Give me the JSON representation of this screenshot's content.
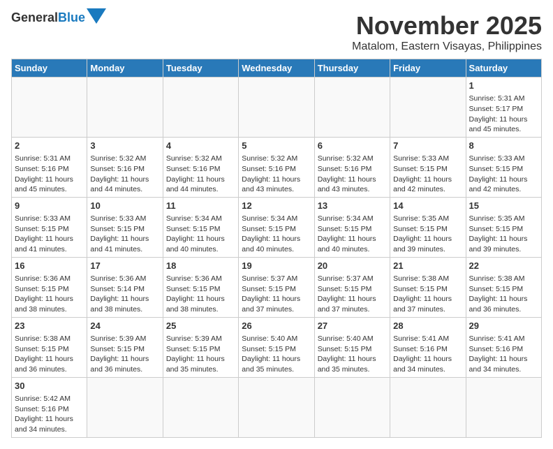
{
  "header": {
    "logo_general": "General",
    "logo_blue": "Blue",
    "month_year": "November 2025",
    "location": "Matalom, Eastern Visayas, Philippines"
  },
  "days_of_week": [
    "Sunday",
    "Monday",
    "Tuesday",
    "Wednesday",
    "Thursday",
    "Friday",
    "Saturday"
  ],
  "weeks": [
    [
      {
        "day": "",
        "empty": true
      },
      {
        "day": "",
        "empty": true
      },
      {
        "day": "",
        "empty": true
      },
      {
        "day": "",
        "empty": true
      },
      {
        "day": "",
        "empty": true
      },
      {
        "day": "",
        "empty": true
      },
      {
        "day": "1",
        "sunrise": "Sunrise: 5:31 AM",
        "sunset": "Sunset: 5:17 PM",
        "daylight": "Daylight: 11 hours and 45 minutes."
      }
    ],
    [
      {
        "day": "2",
        "sunrise": "Sunrise: 5:31 AM",
        "sunset": "Sunset: 5:16 PM",
        "daylight": "Daylight: 11 hours and 45 minutes."
      },
      {
        "day": "3",
        "sunrise": "Sunrise: 5:32 AM",
        "sunset": "Sunset: 5:16 PM",
        "daylight": "Daylight: 11 hours and 44 minutes."
      },
      {
        "day": "4",
        "sunrise": "Sunrise: 5:32 AM",
        "sunset": "Sunset: 5:16 PM",
        "daylight": "Daylight: 11 hours and 44 minutes."
      },
      {
        "day": "5",
        "sunrise": "Sunrise: 5:32 AM",
        "sunset": "Sunset: 5:16 PM",
        "daylight": "Daylight: 11 hours and 43 minutes."
      },
      {
        "day": "6",
        "sunrise": "Sunrise: 5:32 AM",
        "sunset": "Sunset: 5:16 PM",
        "daylight": "Daylight: 11 hours and 43 minutes."
      },
      {
        "day": "7",
        "sunrise": "Sunrise: 5:33 AM",
        "sunset": "Sunset: 5:15 PM",
        "daylight": "Daylight: 11 hours and 42 minutes."
      },
      {
        "day": "8",
        "sunrise": "Sunrise: 5:33 AM",
        "sunset": "Sunset: 5:15 PM",
        "daylight": "Daylight: 11 hours and 42 minutes."
      }
    ],
    [
      {
        "day": "9",
        "sunrise": "Sunrise: 5:33 AM",
        "sunset": "Sunset: 5:15 PM",
        "daylight": "Daylight: 11 hours and 41 minutes."
      },
      {
        "day": "10",
        "sunrise": "Sunrise: 5:33 AM",
        "sunset": "Sunset: 5:15 PM",
        "daylight": "Daylight: 11 hours and 41 minutes."
      },
      {
        "day": "11",
        "sunrise": "Sunrise: 5:34 AM",
        "sunset": "Sunset: 5:15 PM",
        "daylight": "Daylight: 11 hours and 40 minutes."
      },
      {
        "day": "12",
        "sunrise": "Sunrise: 5:34 AM",
        "sunset": "Sunset: 5:15 PM",
        "daylight": "Daylight: 11 hours and 40 minutes."
      },
      {
        "day": "13",
        "sunrise": "Sunrise: 5:34 AM",
        "sunset": "Sunset: 5:15 PM",
        "daylight": "Daylight: 11 hours and 40 minutes."
      },
      {
        "day": "14",
        "sunrise": "Sunrise: 5:35 AM",
        "sunset": "Sunset: 5:15 PM",
        "daylight": "Daylight: 11 hours and 39 minutes."
      },
      {
        "day": "15",
        "sunrise": "Sunrise: 5:35 AM",
        "sunset": "Sunset: 5:15 PM",
        "daylight": "Daylight: 11 hours and 39 minutes."
      }
    ],
    [
      {
        "day": "16",
        "sunrise": "Sunrise: 5:36 AM",
        "sunset": "Sunset: 5:15 PM",
        "daylight": "Daylight: 11 hours and 38 minutes."
      },
      {
        "day": "17",
        "sunrise": "Sunrise: 5:36 AM",
        "sunset": "Sunset: 5:14 PM",
        "daylight": "Daylight: 11 hours and 38 minutes."
      },
      {
        "day": "18",
        "sunrise": "Sunrise: 5:36 AM",
        "sunset": "Sunset: 5:15 PM",
        "daylight": "Daylight: 11 hours and 38 minutes."
      },
      {
        "day": "19",
        "sunrise": "Sunrise: 5:37 AM",
        "sunset": "Sunset: 5:15 PM",
        "daylight": "Daylight: 11 hours and 37 minutes."
      },
      {
        "day": "20",
        "sunrise": "Sunrise: 5:37 AM",
        "sunset": "Sunset: 5:15 PM",
        "daylight": "Daylight: 11 hours and 37 minutes."
      },
      {
        "day": "21",
        "sunrise": "Sunrise: 5:38 AM",
        "sunset": "Sunset: 5:15 PM",
        "daylight": "Daylight: 11 hours and 37 minutes."
      },
      {
        "day": "22",
        "sunrise": "Sunrise: 5:38 AM",
        "sunset": "Sunset: 5:15 PM",
        "daylight": "Daylight: 11 hours and 36 minutes."
      }
    ],
    [
      {
        "day": "23",
        "sunrise": "Sunrise: 5:38 AM",
        "sunset": "Sunset: 5:15 PM",
        "daylight": "Daylight: 11 hours and 36 minutes."
      },
      {
        "day": "24",
        "sunrise": "Sunrise: 5:39 AM",
        "sunset": "Sunset: 5:15 PM",
        "daylight": "Daylight: 11 hours and 36 minutes."
      },
      {
        "day": "25",
        "sunrise": "Sunrise: 5:39 AM",
        "sunset": "Sunset: 5:15 PM",
        "daylight": "Daylight: 11 hours and 35 minutes."
      },
      {
        "day": "26",
        "sunrise": "Sunrise: 5:40 AM",
        "sunset": "Sunset: 5:15 PM",
        "daylight": "Daylight: 11 hours and 35 minutes."
      },
      {
        "day": "27",
        "sunrise": "Sunrise: 5:40 AM",
        "sunset": "Sunset: 5:15 PM",
        "daylight": "Daylight: 11 hours and 35 minutes."
      },
      {
        "day": "28",
        "sunrise": "Sunrise: 5:41 AM",
        "sunset": "Sunset: 5:16 PM",
        "daylight": "Daylight: 11 hours and 34 minutes."
      },
      {
        "day": "29",
        "sunrise": "Sunrise: 5:41 AM",
        "sunset": "Sunset: 5:16 PM",
        "daylight": "Daylight: 11 hours and 34 minutes."
      }
    ],
    [
      {
        "day": "30",
        "sunrise": "Sunrise: 5:42 AM",
        "sunset": "Sunset: 5:16 PM",
        "daylight": "Daylight: 11 hours and 34 minutes."
      },
      {
        "day": "",
        "empty": true
      },
      {
        "day": "",
        "empty": true
      },
      {
        "day": "",
        "empty": true
      },
      {
        "day": "",
        "empty": true
      },
      {
        "day": "",
        "empty": true
      },
      {
        "day": "",
        "empty": true
      }
    ]
  ]
}
